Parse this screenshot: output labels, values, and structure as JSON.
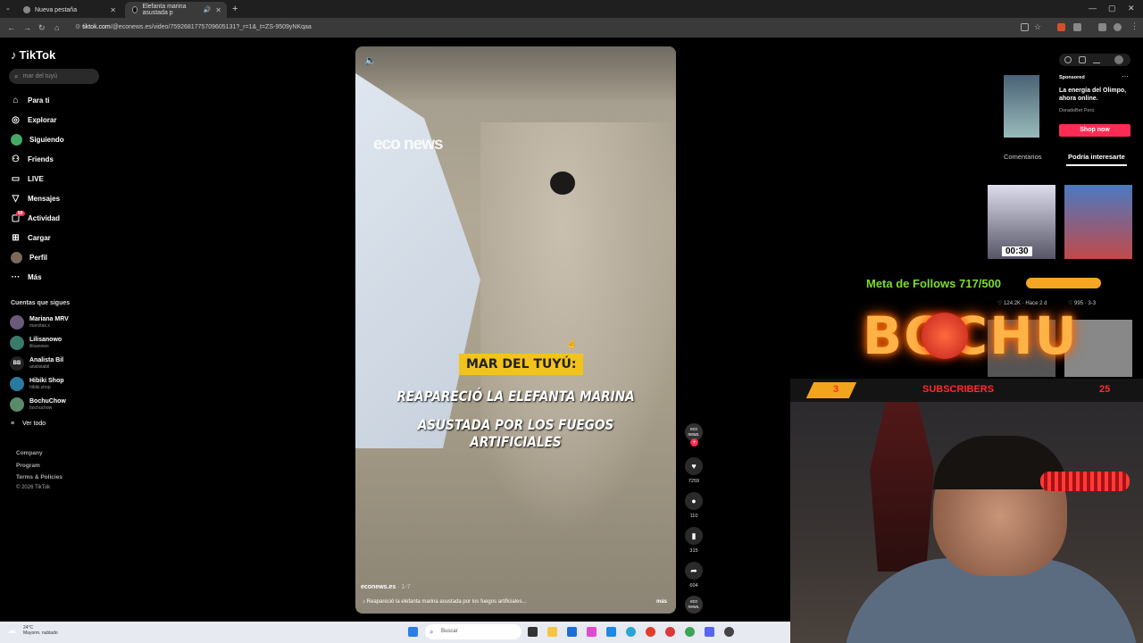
{
  "browser": {
    "tabs": [
      {
        "label": "Nueva pestaña",
        "active": false
      },
      {
        "label": "Elefanta marina asustada p",
        "active": true
      }
    ],
    "url_domain": "tiktok.com",
    "url_path": "/@econews.es/video/7592681775709605131?_r=1&_t=ZS-9509yNKqaa"
  },
  "sidebar": {
    "logo": "TikTok",
    "search_placeholder": "mar del tuyú",
    "nav": [
      {
        "label": "Para ti",
        "icon": "home-icon"
      },
      {
        "label": "Explorar",
        "icon": "compass-icon"
      },
      {
        "label": "Siguiendo",
        "icon": "following-icon"
      },
      {
        "label": "Friends",
        "icon": "friends-icon"
      },
      {
        "label": "LIVE",
        "icon": "live-icon"
      },
      {
        "label": "Mensajes",
        "icon": "send-icon"
      },
      {
        "label": "Actividad",
        "icon": "bell-icon",
        "badge": "50"
      },
      {
        "label": "Cargar",
        "icon": "upload-icon"
      },
      {
        "label": "Perfil",
        "icon": "profile-icon"
      },
      {
        "label": "Más",
        "icon": "more-icon"
      }
    ],
    "following_title": "Cuentas que sigues",
    "accounts": [
      {
        "name": "Mariana MRV",
        "handle": "marcitax.x"
      },
      {
        "name": "Lilisanowo",
        "handle": "lilisanowo"
      },
      {
        "name": "Analista Bil",
        "handle": "analistabil",
        "initials": "BB"
      },
      {
        "name": "Hibiki Shop",
        "handle": "hibiki.shop"
      },
      {
        "name": "BochuChow",
        "handle": "bochuchow"
      }
    ],
    "see_all": "Ver todo",
    "footer": [
      "Company",
      "Program",
      "Terms & Policies",
      "© 2026 TikTok"
    ]
  },
  "video": {
    "watermark": "eco news",
    "tag": "MAR DEL TUYÚ:",
    "caption_lines": [
      "REAPARECIÓ LA ELEFANTA MARINA",
      "ASUSTADA POR LOS FUEGOS ARTIFICIALES"
    ],
    "author": "econews.es",
    "age": "· 1-7",
    "description": "Reapareció la elefanta marina asustada por los fuegos artificiales...",
    "more": "más"
  },
  "actions": {
    "avatar_text": "eco news.",
    "likes": "7259",
    "comments": "110",
    "saves": "315",
    "shares": "604"
  },
  "right_panel": {
    "sponsored": "Sponsored",
    "ad_title": "La energía del Olimpo, ahora online.",
    "ad_advertiser": "DoradoBet Perú",
    "ad_button": "Shop now",
    "tabs": [
      "Comentarios",
      "Podría interesarte"
    ],
    "thumb_timer": "00:30",
    "thumb_stats_1": "124.2K · Hace 2 d",
    "thumb_stats_2": "995 · 3-3"
  },
  "overlay": {
    "goal_text": "Meta de Follows 717/500",
    "goal_progress": 1.0,
    "brand": "BOCHU",
    "subs_left": "3",
    "subs_label": "SUBSCRIBERS",
    "subs_right": "25"
  },
  "taskbar": {
    "weather_temp": "24°C",
    "weather_desc": "Mayorm. nublado",
    "search_placeholder": "Buscar"
  },
  "colors": {
    "accent": "#fe2c55",
    "goal_green": "#7ddc2a",
    "goal_bar": "#f6a623",
    "subs_red": "#ff2a2a",
    "caption_tag": "#f2c41b"
  }
}
